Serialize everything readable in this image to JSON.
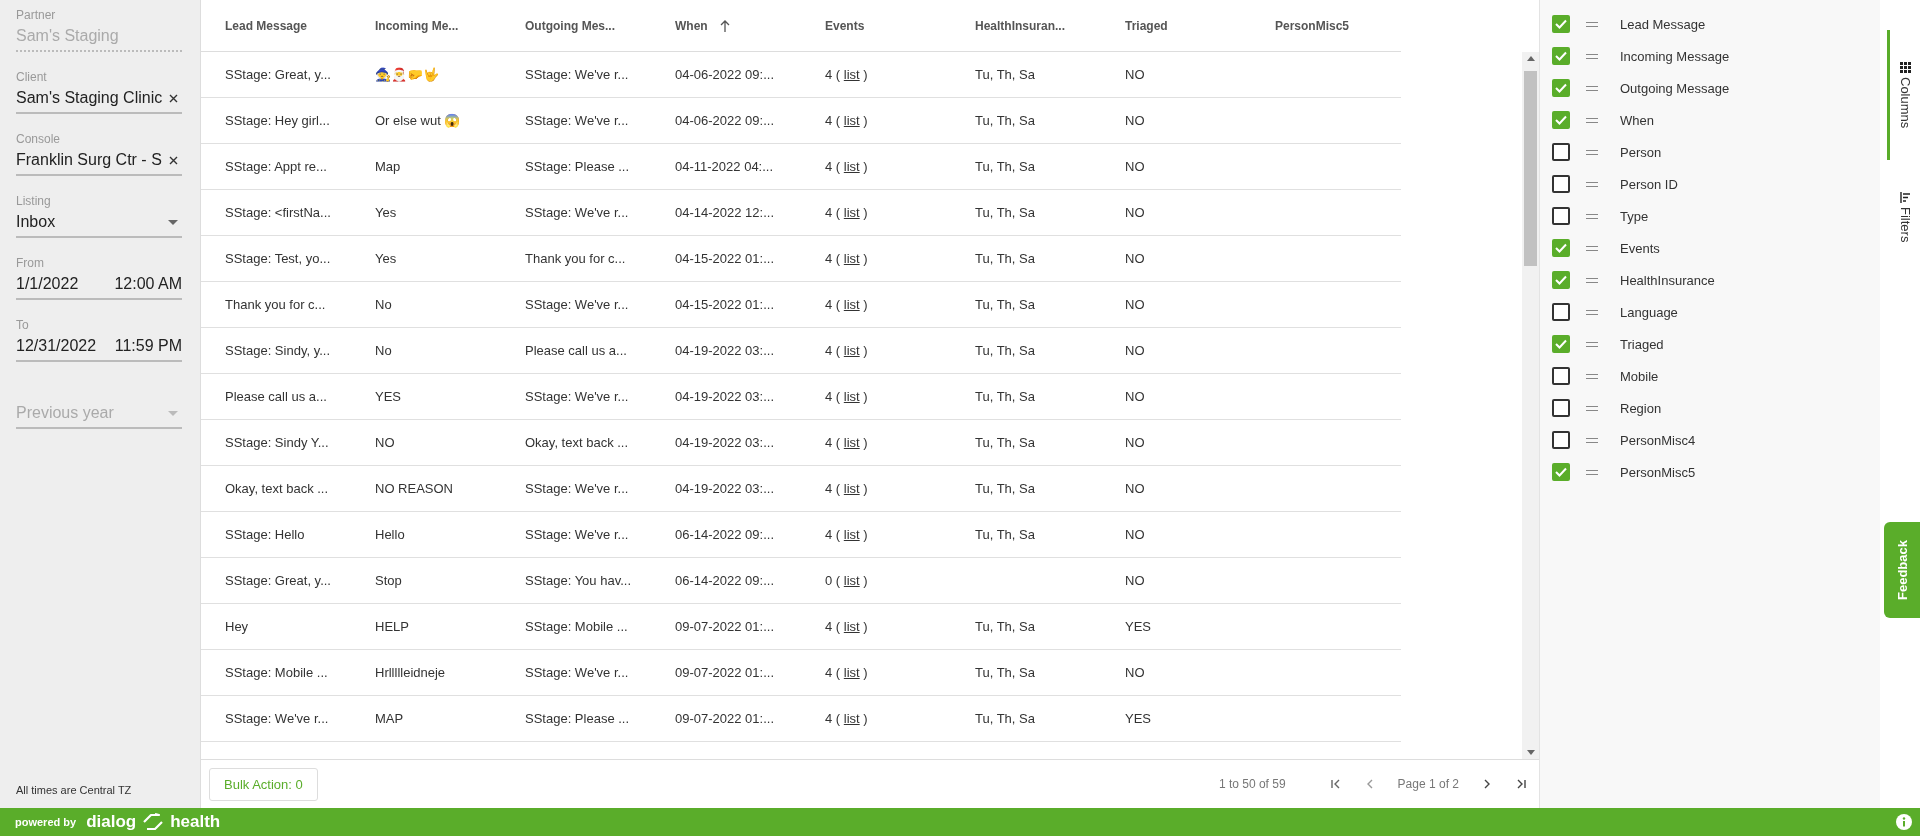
{
  "sidebar": {
    "fields": [
      {
        "kind": "readonly",
        "label": "Partner",
        "value": "Sam's Staging",
        "disabled": true
      },
      {
        "kind": "clearable",
        "label": "Client",
        "value": "Sam's Staging Clinic"
      },
      {
        "kind": "clearable",
        "label": "Console",
        "value": "Franklin Surg Ctr - S"
      },
      {
        "kind": "select",
        "label": "Listing",
        "value": "Inbox"
      },
      {
        "kind": "datetime",
        "label": "From",
        "value": "1/1/2022",
        "time": "12:00 AM"
      },
      {
        "kind": "datetime",
        "label": "To",
        "value": "12/31/2022",
        "time": "11:59 PM"
      },
      {
        "kind": "preset",
        "value": "Previous year",
        "disabled": true
      }
    ],
    "tz_note": "All times are Central TZ"
  },
  "table": {
    "columns": [
      {
        "label": "Lead Message",
        "sorted": false
      },
      {
        "label": "Incoming Me...",
        "sorted": false
      },
      {
        "label": "Outgoing Mes...",
        "sorted": false
      },
      {
        "label": "When",
        "sorted": true
      },
      {
        "label": "Events",
        "sorted": false
      },
      {
        "label": "HealthInsuran...",
        "sorted": false
      },
      {
        "label": "Triaged",
        "sorted": false
      },
      {
        "label": "PersonMisc5",
        "sorted": false
      }
    ],
    "rows": [
      {
        "lead": "SStage: Great, y...",
        "incoming": "🧙🎅🤛🤟",
        "outgoing": "SStage: We've r...",
        "when": "04-06-2022 09:...",
        "events": "4 (",
        "link": "list",
        "events_end": ")",
        "health": "Tu, Th, Sa",
        "triaged": "NO"
      },
      {
        "lead": "SStage: Hey girl...",
        "incoming": "Or else wut 😱",
        "outgoing": "SStage: We've r...",
        "when": "04-06-2022 09:...",
        "events": "4 (",
        "link": "list",
        "events_end": ")",
        "health": "Tu, Th, Sa",
        "triaged": "NO"
      },
      {
        "lead": "SStage: Appt re...",
        "incoming": "Map",
        "outgoing": "SStage: Please ...",
        "when": "04-11-2022 04:...",
        "events": "4 (",
        "link": "list",
        "events_end": ")",
        "health": "Tu, Th, Sa",
        "triaged": "NO"
      },
      {
        "lead": "SStage: <firstNa...",
        "incoming": "Yes",
        "outgoing": "SStage: We've r...",
        "when": "04-14-2022 12:...",
        "events": "4 (",
        "link": "list",
        "events_end": ")",
        "health": "Tu, Th, Sa",
        "triaged": "NO"
      },
      {
        "lead": "SStage: Test, yo...",
        "incoming": "Yes",
        "outgoing": "Thank you for c...",
        "when": "04-15-2022 01:...",
        "events": "4 (",
        "link": "list",
        "events_end": ")",
        "health": "Tu, Th, Sa",
        "triaged": "NO"
      },
      {
        "lead": "Thank you for c...",
        "incoming": "No",
        "outgoing": "SStage: We've r...",
        "when": "04-15-2022 01:...",
        "events": "4 (",
        "link": "list",
        "events_end": ")",
        "health": "Tu, Th, Sa",
        "triaged": "NO"
      },
      {
        "lead": "SStage: Sindy, y...",
        "incoming": "No",
        "outgoing": "Please call us a...",
        "when": "04-19-2022 03:...",
        "events": "4 (",
        "link": "list",
        "events_end": ")",
        "health": "Tu, Th, Sa",
        "triaged": "NO"
      },
      {
        "lead": "Please call us a...",
        "incoming": "YES",
        "outgoing": "SStage: We've r...",
        "when": "04-19-2022 03:...",
        "events": "4 (",
        "link": "list",
        "events_end": ")",
        "health": "Tu, Th, Sa",
        "triaged": "NO"
      },
      {
        "lead": "SStage: Sindy Y...",
        "incoming": "NO",
        "outgoing": "Okay, text back ...",
        "when": "04-19-2022 03:...",
        "events": "4 (",
        "link": "list",
        "events_end": ")",
        "health": "Tu, Th, Sa",
        "triaged": "NO"
      },
      {
        "lead": "Okay, text back ...",
        "incoming": "NO REASON",
        "outgoing": "SStage: We've r...",
        "when": "04-19-2022 03:...",
        "events": "4 (",
        "link": "list",
        "events_end": ")",
        "health": "Tu, Th, Sa",
        "triaged": "NO"
      },
      {
        "lead": "SStage: Hello",
        "incoming": "Hello",
        "outgoing": "SStage: We've r...",
        "when": "06-14-2022 09:...",
        "events": "4 (",
        "link": "list",
        "events_end": ")",
        "health": "Tu, Th, Sa",
        "triaged": "NO"
      },
      {
        "lead": "SStage: Great, y...",
        "incoming": "Stop",
        "outgoing": "SStage: You hav...",
        "when": "06-14-2022 09:...",
        "events": "0 (",
        "link": "list",
        "events_end": ")",
        "triaged": "NO"
      },
      {
        "lead": "Hey",
        "incoming": "HELP",
        "outgoing": "SStage: Mobile ...",
        "when": "09-07-2022 01:...",
        "events": "4 (",
        "link": "list",
        "events_end": ")",
        "health": "Tu, Th, Sa",
        "triaged": "YES"
      },
      {
        "lead": "SStage: Mobile ...",
        "incoming": "Hrllllleidneje",
        "outgoing": "SStage: We've r...",
        "when": "09-07-2022 01:...",
        "events": "4 (",
        "link": "list",
        "events_end": ")",
        "health": "Tu, Th, Sa",
        "triaged": "NO"
      },
      {
        "lead": "SStage: We've r...",
        "incoming": "MAP",
        "outgoing": "SStage: Please ...",
        "when": "09-07-2022 01:...",
        "events": "4 (",
        "link": "list",
        "events_end": ")",
        "health": "Tu, Th, Sa",
        "triaged": "YES"
      }
    ]
  },
  "column_panel": {
    "items": [
      {
        "label": "Lead Message",
        "checked": true
      },
      {
        "label": "Incoming Message",
        "checked": true
      },
      {
        "label": "Outgoing Message",
        "checked": true
      },
      {
        "label": "When",
        "checked": true
      },
      {
        "label": "Person",
        "checked": false
      },
      {
        "label": "Person ID",
        "checked": false
      },
      {
        "label": "Type",
        "checked": false
      },
      {
        "label": "Events",
        "checked": true
      },
      {
        "label": "HealthInsurance",
        "checked": true
      },
      {
        "label": "Language",
        "checked": false
      },
      {
        "label": "Triaged",
        "checked": true
      },
      {
        "label": "Mobile",
        "checked": false
      },
      {
        "label": "Region",
        "checked": false
      },
      {
        "label": "PersonMisc4",
        "checked": false
      },
      {
        "label": "PersonMisc5",
        "checked": true
      }
    ]
  },
  "side_tabs": [
    {
      "kind": "columns",
      "label": "Columns",
      "selected": true
    },
    {
      "kind": "filters",
      "label": "Filters",
      "selected": false
    }
  ],
  "feedback": "Feedback",
  "bulk_action": "Bulk Action: 0",
  "pagination": {
    "summary": "1 to 50 of 59",
    "page": "Page 1 of 2"
  },
  "footer": {
    "powered_by": "powered by",
    "brand_left": "dialog",
    "brand_right": "health"
  }
}
